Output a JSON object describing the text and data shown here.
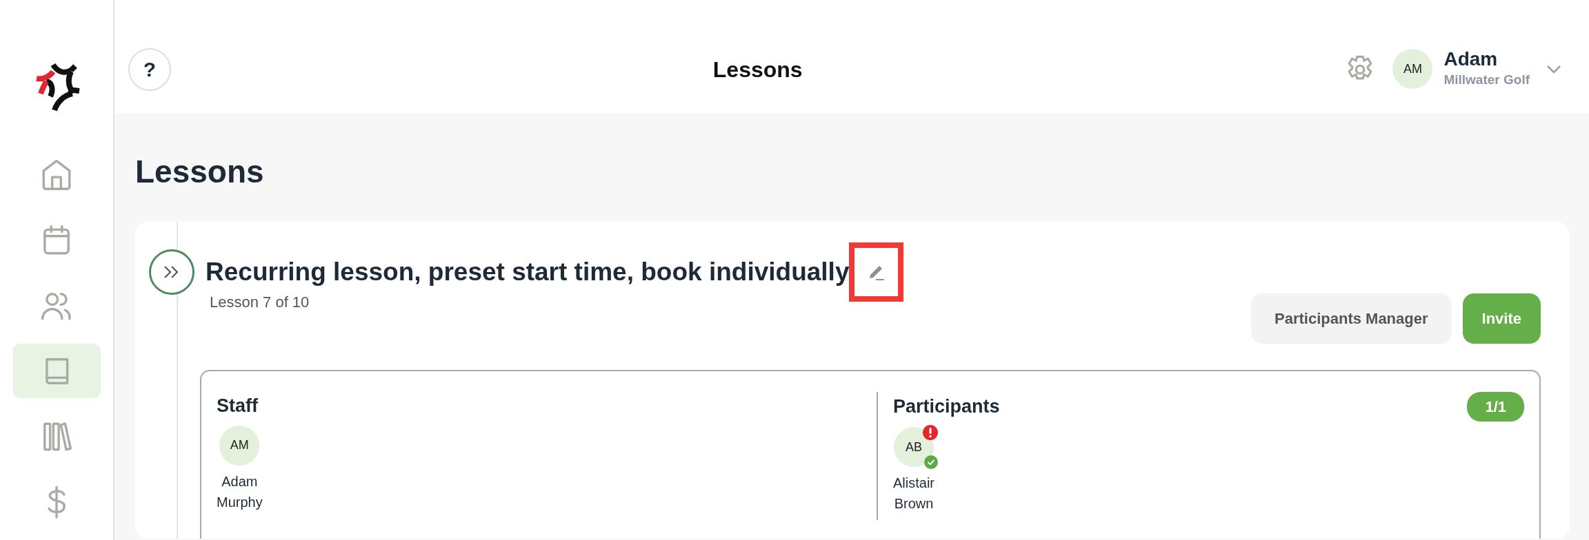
{
  "sidebar": {
    "items": [
      {
        "selected": false
      },
      {
        "selected": false
      },
      {
        "selected": false
      },
      {
        "selected": true
      },
      {
        "selected": false
      },
      {
        "selected": false
      }
    ]
  },
  "header": {
    "help": "?",
    "title": "Lessons",
    "user": {
      "initials": "AM",
      "name": "Adam",
      "organization": "Millwater Golf"
    }
  },
  "page_title": "Lessons",
  "lesson": {
    "title": "Recurring lesson, preset start time, book individually",
    "edit_highlighted": true,
    "progress": "Lesson 7 of 10",
    "buttons": [
      {
        "label": "Participants Manager",
        "kind": "secondary"
      },
      {
        "label": "Invite",
        "kind": "primary"
      }
    ],
    "staff": {
      "heading": "Staff",
      "people": [
        {
          "initials": "AM",
          "first": "Adam",
          "last": "Murphy",
          "alert": false,
          "confirmed": false
        }
      ]
    },
    "participants": {
      "heading": "Participants",
      "count": "1/1",
      "people": [
        {
          "initials": "AB",
          "first": "Alistair",
          "last": "Brown",
          "alert": true,
          "confirmed": true
        }
      ]
    }
  }
}
